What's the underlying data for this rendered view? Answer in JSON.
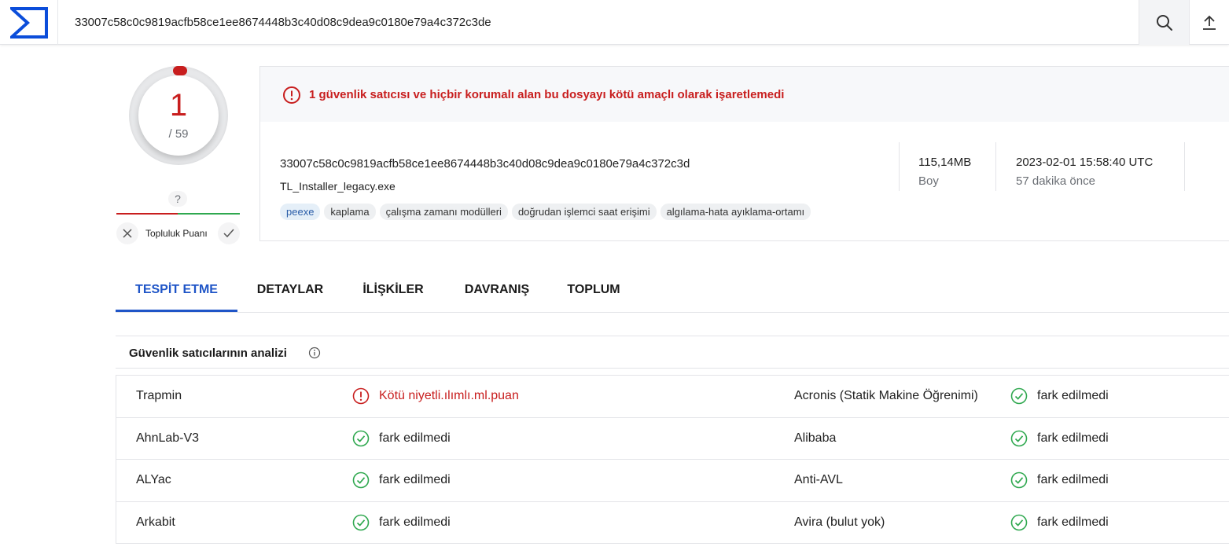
{
  "search": {
    "value": "33007c58c0c9819acfb58ce1ee8674448b3c40d08c9dea9c0180e79a4c372c3de"
  },
  "score": {
    "detections": "1",
    "total": "/ 59"
  },
  "community": {
    "score": "?",
    "label": "Topluluk Puanı"
  },
  "summary": {
    "alert": "1 güvenlik satıcısı ve hiçbir korumalı alan bu dosyayı kötü amaçlı olarak işaretlemedi",
    "hash": "33007c58c0c9819acfb58ce1ee8674448b3c40d08c9dea9c0180e79a4c372c3d",
    "file_name": "TL_Installer_legacy.exe",
    "tags": [
      "peexe",
      "kaplama",
      "çalışma zamanı modülleri",
      "doğrudan işlemci saat erişimi",
      "algılama-hata ayıklama-ortamı"
    ],
    "size_value": "115,14MB",
    "size_label": "Boy",
    "date_value": "2023-02-01 15:58:40 UTC",
    "date_label": "57 dakika önce"
  },
  "tabs": [
    "TESPİT ETME",
    "DETAYLAR",
    "İLİŞKİLER",
    "DAVRANIŞ",
    "TOPLUM"
  ],
  "analysis": {
    "title": "Güvenlik satıcılarının analizi",
    "rows": [
      [
        {
          "vendor": "Trapmin",
          "result": "Kötü niyetli.ılımlı.ml.puan",
          "status": "bad"
        },
        {
          "vendor": "Acronis (Statik Makine Öğrenimi)",
          "result": "fark edilmedi",
          "status": "ok"
        }
      ],
      [
        {
          "vendor": "AhnLab-V3",
          "result": "fark edilmedi",
          "status": "ok"
        },
        {
          "vendor": "Alibaba",
          "result": "fark edilmedi",
          "status": "ok"
        }
      ],
      [
        {
          "vendor": "ALYac",
          "result": "fark edilmedi",
          "status": "ok"
        },
        {
          "vendor": "Anti-AVL",
          "result": "fark edilmedi",
          "status": "ok"
        }
      ],
      [
        {
          "vendor": "Arkabit",
          "result": "fark edilmedi",
          "status": "ok"
        },
        {
          "vendor": "Avira (bulut yok)",
          "result": "fark edilmedi",
          "status": "ok"
        }
      ]
    ]
  },
  "colors": {
    "accent": "#1f55c7",
    "danger": "#c81e1e",
    "ok": "#2fa84f",
    "logo": "#0b4dda"
  }
}
